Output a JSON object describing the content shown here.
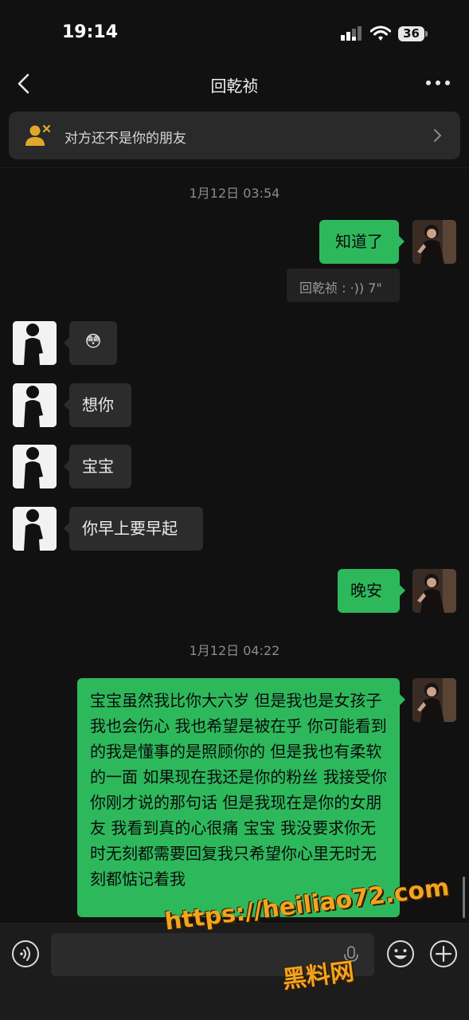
{
  "status_bar": {
    "time": "19:14",
    "battery": "36"
  },
  "nav": {
    "title": "回乾祯"
  },
  "notice": {
    "text": "对方还不是你的朋友"
  },
  "messages": {
    "ts1": "1月12日 03:54",
    "m1": "知道了",
    "voice_note": "回乾祯 : ·)) 7\"",
    "m2_emoji": "😳",
    "m3": "想你",
    "m4": "宝宝",
    "m5": "你早上要早起",
    "m6": "晚安",
    "ts2": "1月12日 04:22",
    "m7": "宝宝虽然我比你大六岁 但是我也是女孩子 我也会伤心 我也希望是被在乎 你可能看到的我是懂事的是照顾你的 但是我也有柔软的一面 如果现在我还是你的粉丝 我接受你你刚才说的那句话 但是我现在是你的女朋友 我看到真的心很痛 宝宝 我没要求你无时无刻都需要回复我只希望你心里无时无刻都惦记着我"
  },
  "watermark": {
    "url": "https://heiliao72.com",
    "name": "黑料网"
  },
  "colors": {
    "background": "#111111",
    "outgoing_bubble": "#2eb85c",
    "incoming_bubble": "#2c2c2c",
    "watermark": "#f0a520"
  }
}
